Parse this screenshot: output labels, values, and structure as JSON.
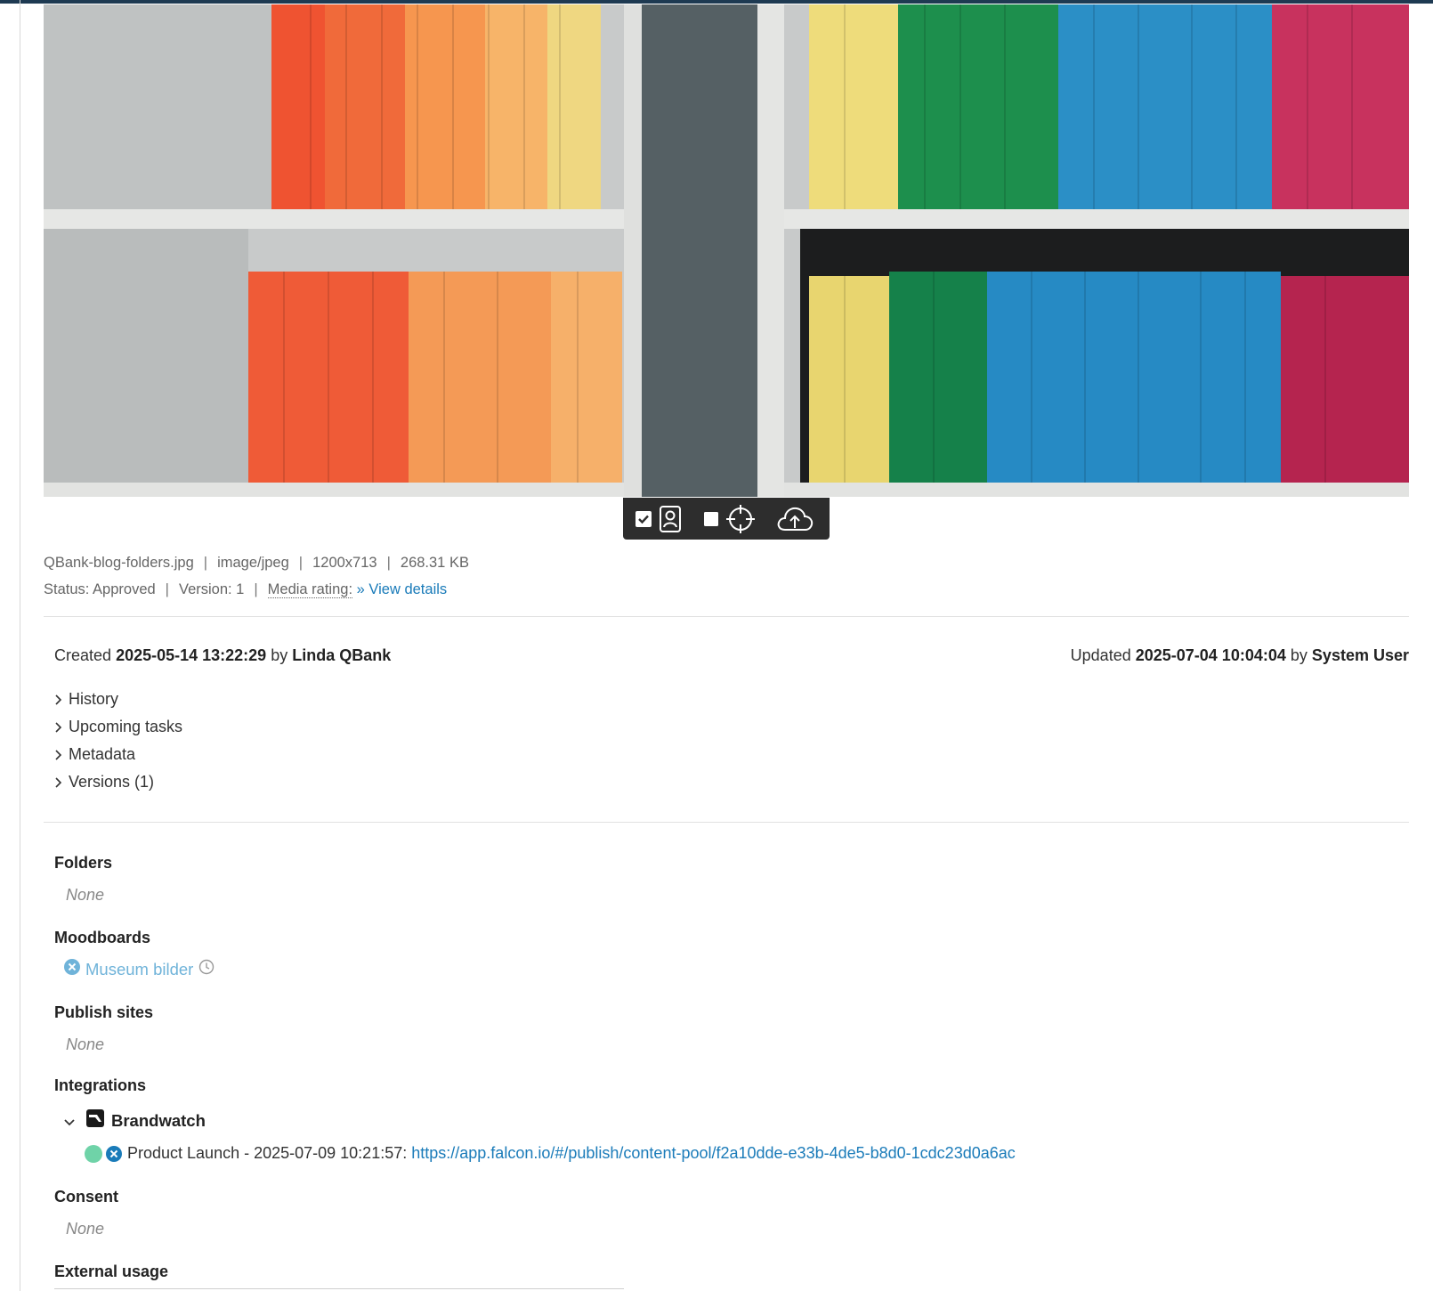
{
  "file": {
    "name": "QBank-blog-folders.jpg",
    "mime": "image/jpeg",
    "dimensions": "1200x713",
    "size": "268.31 KB",
    "status": "Status: Approved",
    "version": "Version: 1",
    "media_rating_label": "Media rating:",
    "view_details": "» View details",
    "separator": "|"
  },
  "created": {
    "label": "Created",
    "date": "2025-05-14 13:22:29",
    "by_label": "by",
    "user": "Linda QBank"
  },
  "updated": {
    "label": "Updated",
    "date": "2025-07-04 10:04:04",
    "by_label": "by",
    "user": "System User"
  },
  "accordions": [
    "History",
    "Upcoming tasks",
    "Metadata",
    "Versions (1)"
  ],
  "sections": {
    "folders": {
      "title": "Folders",
      "value": "None"
    },
    "moodboards": {
      "title": "Moodboards",
      "items": [
        "Museum bilder"
      ]
    },
    "publish_sites": {
      "title": "Publish sites",
      "value": "None"
    },
    "integrations": {
      "title": "Integrations",
      "provider": "Brandwatch",
      "item_text": "Product Launch - 2025-07-09 10:21:57:",
      "item_url": "https://app.falcon.io/#/publish/content-pool/f2a10dde-e33b-4de5-b8d0-1cdc23d0a6ac"
    },
    "consent": {
      "title": "Consent",
      "value": "None"
    },
    "external_usage": {
      "title": "External usage"
    }
  },
  "toolbar_icons": [
    "checkbox-checked-icon",
    "portrait-icon",
    "checkbox-empty-icon",
    "crosshair-icon",
    "cloud-upload-icon"
  ],
  "colors": {
    "accent_link": "#1a7bb9",
    "moodboard_link": "#6fb3d9",
    "status_green": "#6fd3a8",
    "topbar": "#1e3a52",
    "toolbar_bg": "#2d2d2d"
  }
}
